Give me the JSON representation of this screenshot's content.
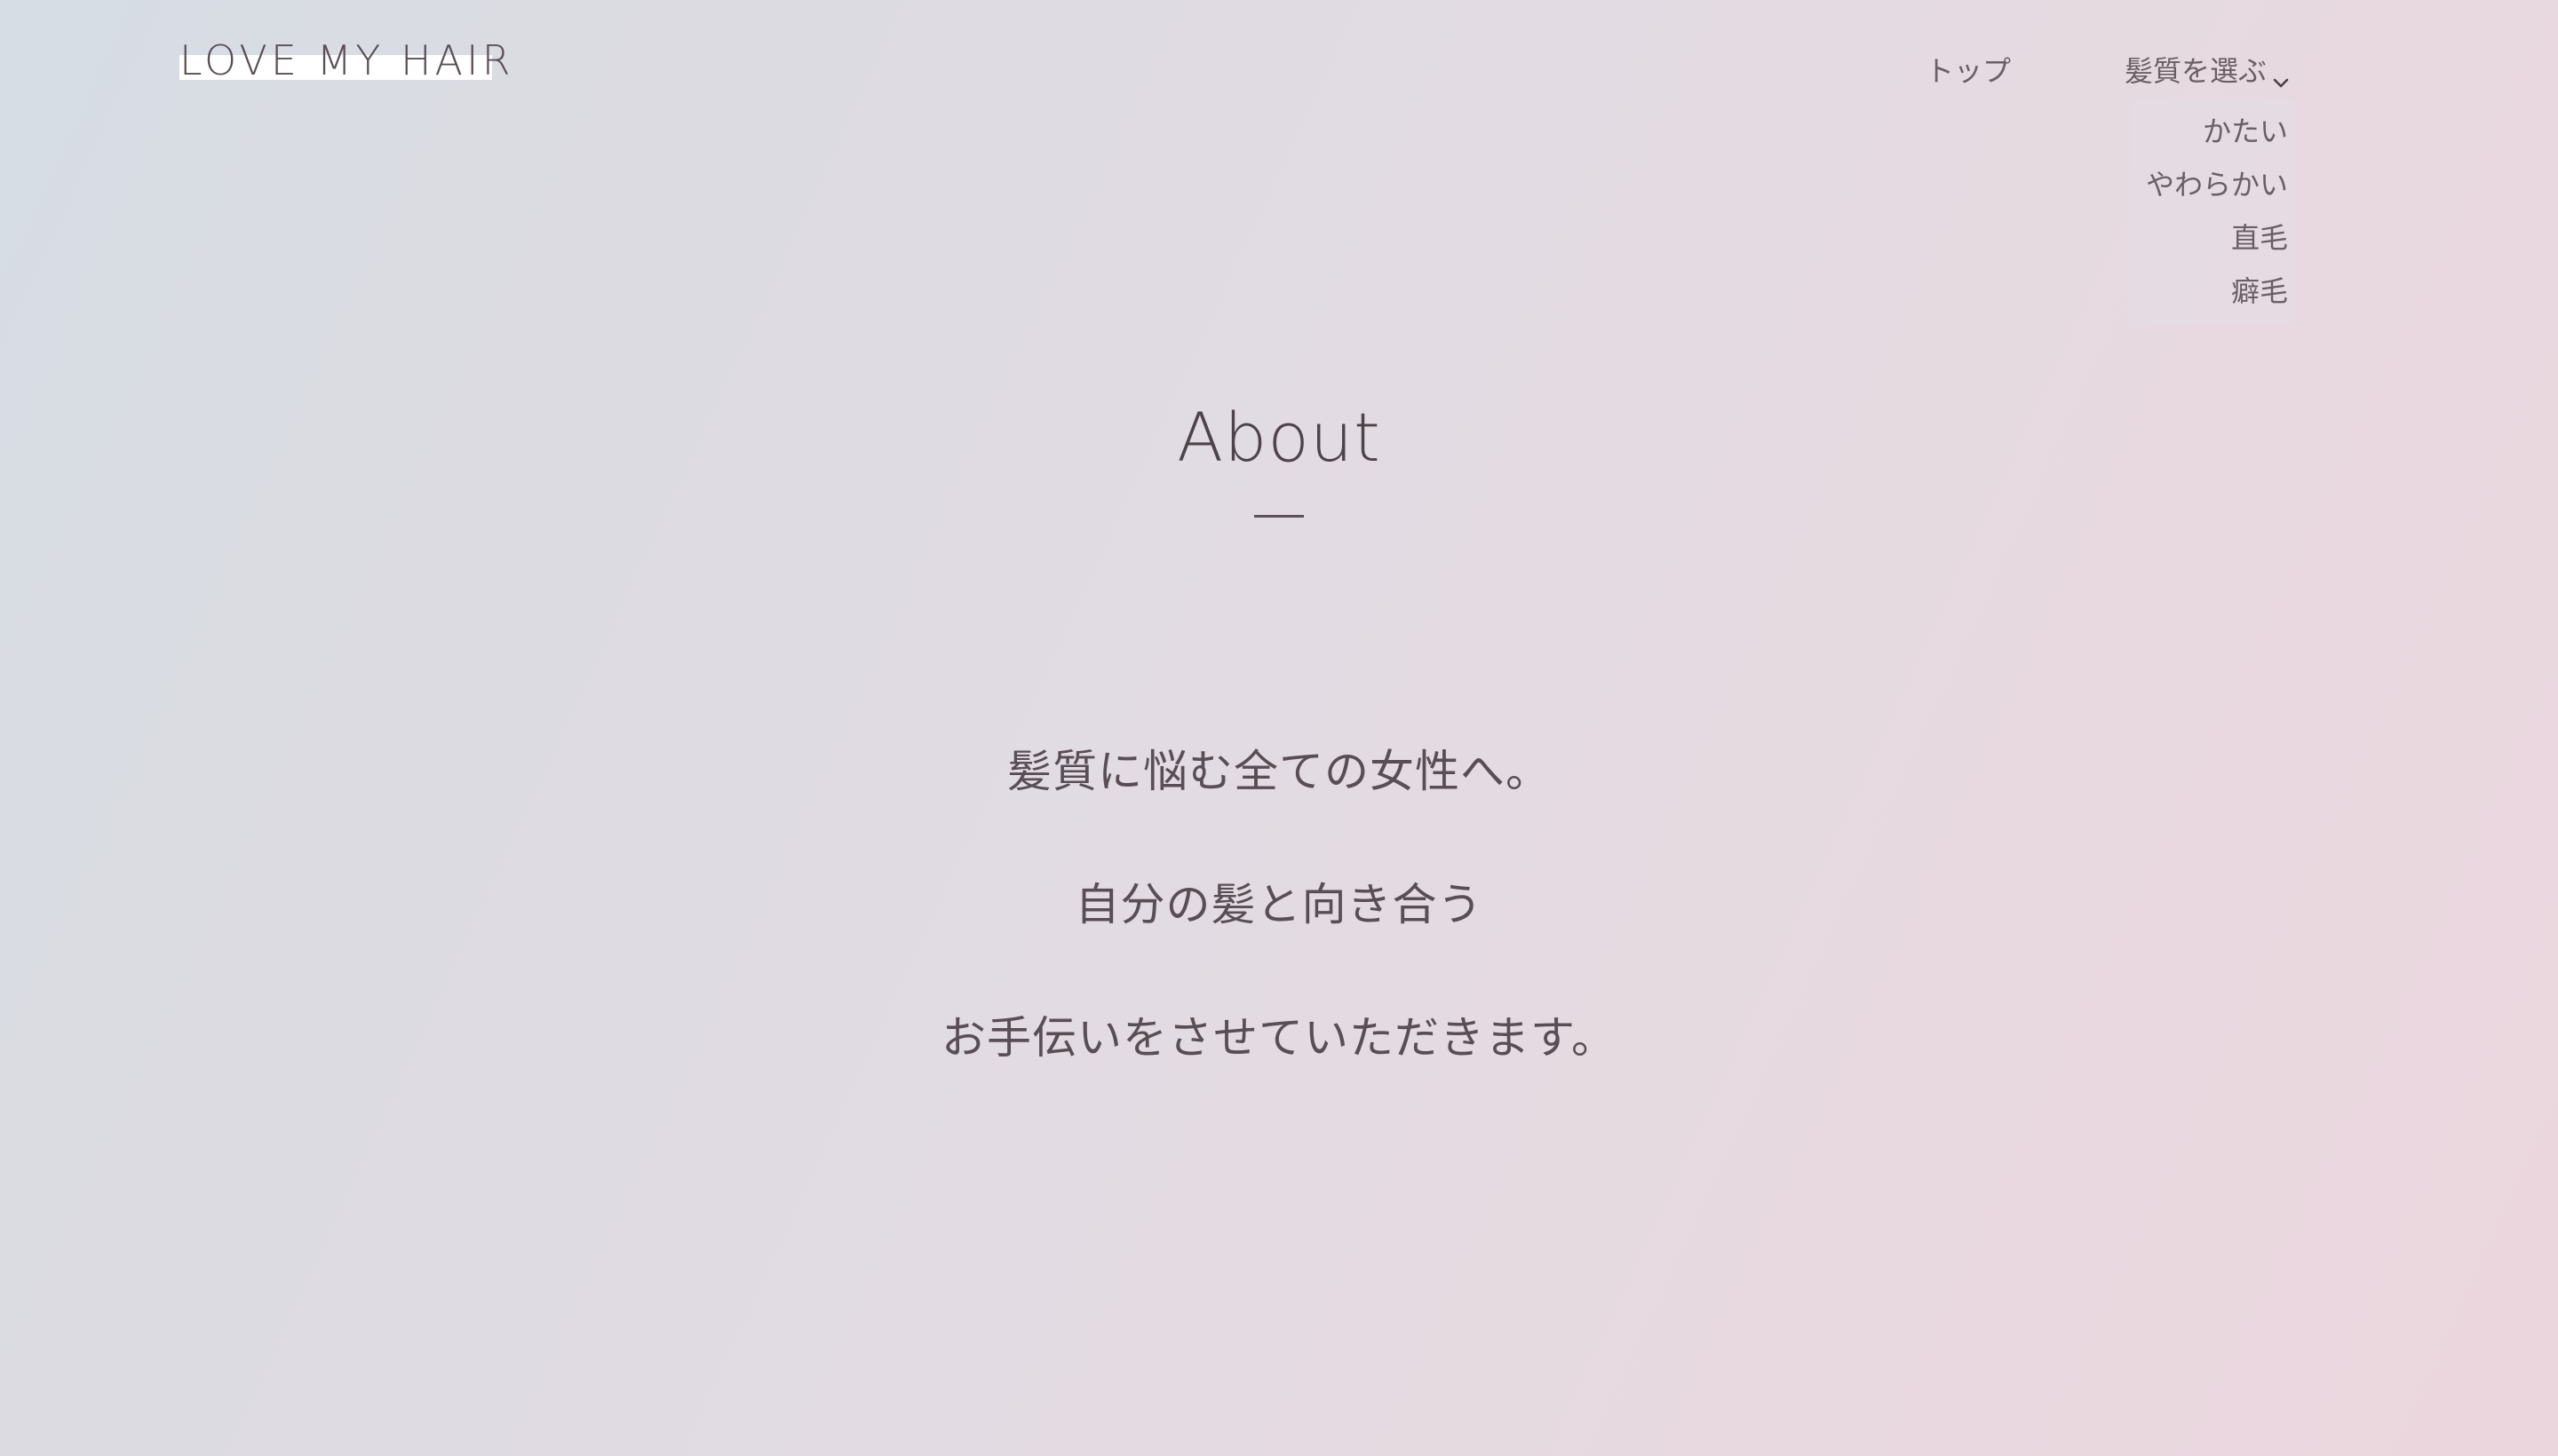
{
  "header": {
    "logo": "LOVE MY HAIR",
    "nav": {
      "top_label": "トップ",
      "dropdown_label": "髪質を選ぶ",
      "dropdown_items": [
        "かたい",
        "やわらかい",
        "直毛",
        "癖毛"
      ]
    }
  },
  "about": {
    "title": "About",
    "lines": [
      "髪質に悩む全ての女性へ。",
      "自分の髪と向き合う",
      "お手伝いをさせていただきます。"
    ]
  },
  "colors": {
    "text": "#4a3f47",
    "gradient_start": "#d6dde4",
    "gradient_end": "#ecd6de",
    "logo_highlight": "#ffffff"
  }
}
